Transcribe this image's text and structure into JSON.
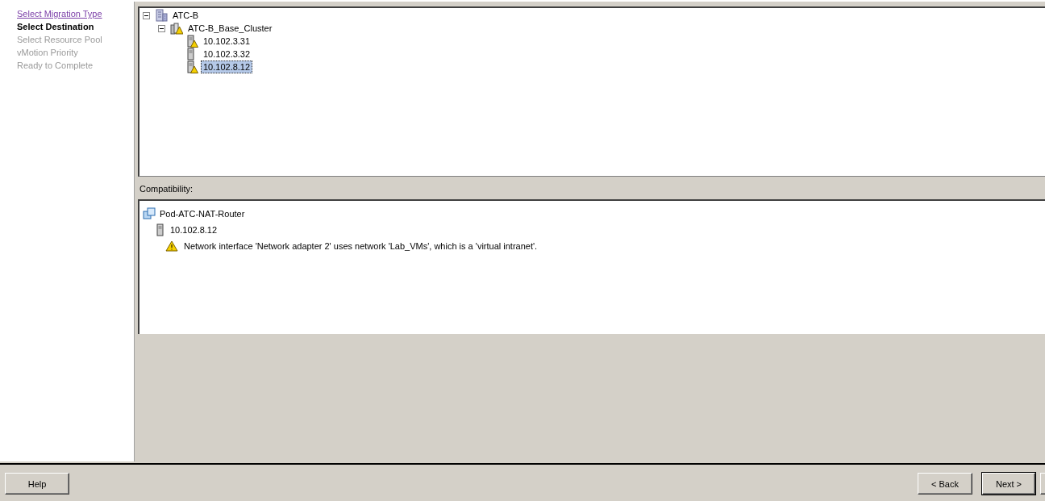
{
  "steps": [
    {
      "label": "Select Migration Type",
      "kind": "link"
    },
    {
      "label": "Select Destination",
      "kind": "current"
    },
    {
      "label": "Select Resource Pool",
      "kind": "pending"
    },
    {
      "label": "vMotion Priority",
      "kind": "pending"
    },
    {
      "label": "Ready to Complete",
      "kind": "pending"
    }
  ],
  "tree": [
    {
      "label": "ATC-B",
      "kind": "datacenter",
      "expanded": true,
      "warning": false,
      "selected": false,
      "children": [
        {
          "label": "ATC-B_Base_Cluster",
          "kind": "cluster",
          "expanded": true,
          "warning": true,
          "selected": false,
          "children": [
            {
              "label": "10.102.3.31",
              "kind": "host",
              "warning": true,
              "selected": false
            },
            {
              "label": "10.102.3.32",
              "kind": "host",
              "warning": false,
              "selected": false
            },
            {
              "label": "10.102.8.12",
              "kind": "host",
              "warning": true,
              "selected": true
            }
          ]
        }
      ]
    }
  ],
  "compatibility": {
    "label": "Compatibility:",
    "vm": "Pod-ATC-NAT-Router",
    "host": "10.102.8.12",
    "message": "Network interface 'Network adapter 2' uses network 'Lab_VMs', which is a 'virtual intranet'."
  },
  "buttons": {
    "help": "Help",
    "back": "< Back",
    "next": "Next >"
  }
}
